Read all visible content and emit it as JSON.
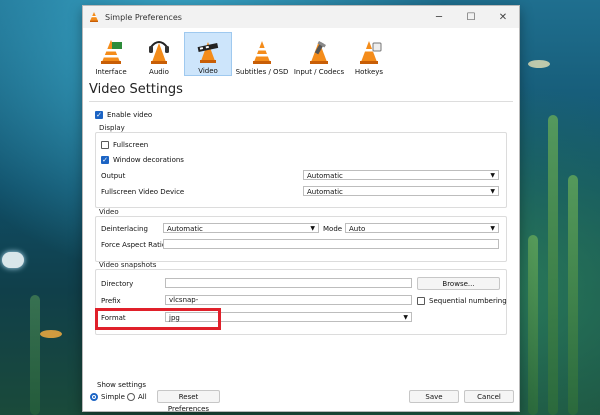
{
  "window": {
    "title": "Simple Preferences"
  },
  "toolbar": {
    "tabs": [
      {
        "label": "Interface",
        "icon": "interface-icon"
      },
      {
        "label": "Audio",
        "icon": "audio-icon"
      },
      {
        "label": "Video",
        "icon": "video-icon",
        "active": true
      },
      {
        "label": "Subtitles / OSD",
        "icon": "subtitles-icon"
      },
      {
        "label": "Input / Codecs",
        "icon": "input-codecs-icon"
      },
      {
        "label": "Hotkeys",
        "icon": "hotkeys-icon"
      }
    ]
  },
  "page": {
    "title": "Video Settings"
  },
  "enable_video": {
    "label": "Enable video",
    "checked": true
  },
  "display": {
    "title": "Display",
    "fullscreen": {
      "label": "Fullscreen",
      "checked": false
    },
    "window_decorations": {
      "label": "Window decorations",
      "checked": true
    },
    "output": {
      "label": "Output",
      "value": "Automatic"
    },
    "fullscreen_device": {
      "label": "Fullscreen Video Device",
      "value": "Automatic"
    }
  },
  "video": {
    "title": "Video",
    "deinterlacing": {
      "label": "Deinterlacing",
      "value": "Automatic"
    },
    "mode": {
      "label": "Mode",
      "value": "Auto"
    },
    "aspect_ratio": {
      "label": "Force Aspect Ratio",
      "value": ""
    }
  },
  "snapshots": {
    "title": "Video snapshots",
    "directory": {
      "label": "Directory",
      "value": ""
    },
    "browse_label": "Browse...",
    "prefix": {
      "label": "Prefix",
      "value": "vlcsnap-"
    },
    "sequential": {
      "label": "Sequential numbering",
      "checked": false
    },
    "format": {
      "label": "Format",
      "value": "jpg"
    }
  },
  "footer": {
    "show_settings_label": "Show settings",
    "simple_label": "Simple",
    "all_label": "All",
    "reset_label": "Reset Preferences",
    "save_label": "Save",
    "cancel_label": "Cancel"
  },
  "colors": {
    "accent": "#1c64c4",
    "highlight": "#e0202a",
    "active_tab": "#cde5fb"
  }
}
